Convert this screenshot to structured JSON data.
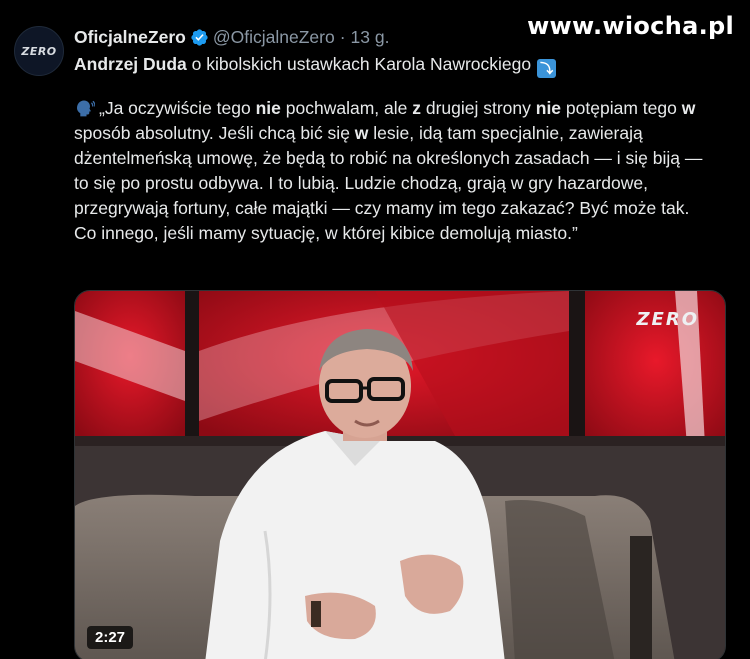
{
  "watermark": "www.wiocha.pl",
  "tweet": {
    "avatar_text": "ZERO",
    "display_name": "OficjalneZero",
    "handle": "@OficjalneZero",
    "separator": "·",
    "time": "13 g.",
    "headline_bold": "Andrzej Duda",
    "headline_rest": " o kibolskich ustawkach Karola Nawrockiego",
    "headline_arrow": "⤵",
    "quote": {
      "p1": "„Ja oczywiście tego ",
      "b1": "nie",
      "p2": " pochwalam, ale ",
      "b2": "z",
      "p3": " drugiej strony ",
      "b3": "nie",
      "p4": " potępiam tego ",
      "b4": "w",
      "p5": " sposób absolutny. Jeśli chcą bić się ",
      "b5": "w",
      "p6": " lesie, idą tam specjalnie, zawierają dżentelmeńską umowę, że będą to robić na określonych zasadach — i się biją — to się po prostu odbywa. I to lubią. Ludzie chodzą, grają w gry hazardowe, przegrywają fortuny, całe majątki — czy mamy im tego zakazać? Być może tak. Co innego, jeśli mamy sytuację, w której kibice demolują miasto.”"
    },
    "media": {
      "duration": "2:27",
      "channel_logo": "ZERO"
    }
  },
  "colors": {
    "verified_blue": "#1d9bf0",
    "secondary_text": "#8b98a5",
    "studio_red": "#c8101e"
  },
  "icons": {
    "verified": "verified-badge-icon",
    "headline_arrow": "arrow-down-right-icon",
    "speaking": "speaking-head-icon"
  }
}
